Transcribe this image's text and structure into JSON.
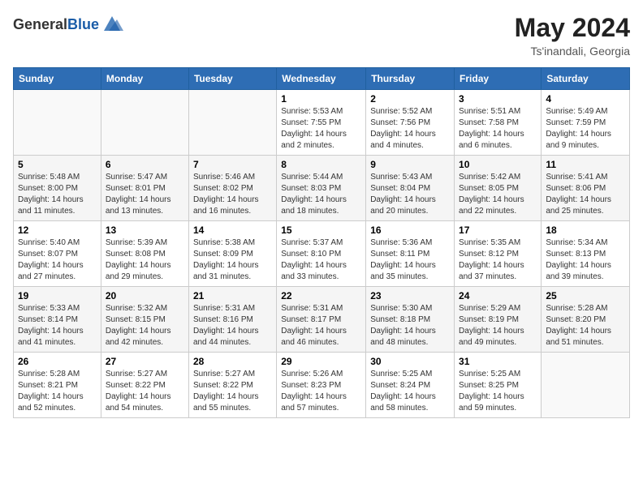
{
  "header": {
    "logo_general": "General",
    "logo_blue": "Blue",
    "title": "May 2024",
    "location": "Ts'inandali, Georgia"
  },
  "calendar": {
    "weekdays": [
      "Sunday",
      "Monday",
      "Tuesday",
      "Wednesday",
      "Thursday",
      "Friday",
      "Saturday"
    ],
    "weeks": [
      [
        {
          "day": "",
          "info": ""
        },
        {
          "day": "",
          "info": ""
        },
        {
          "day": "",
          "info": ""
        },
        {
          "day": "1",
          "info": "Sunrise: 5:53 AM\nSunset: 7:55 PM\nDaylight: 14 hours\nand 2 minutes."
        },
        {
          "day": "2",
          "info": "Sunrise: 5:52 AM\nSunset: 7:56 PM\nDaylight: 14 hours\nand 4 minutes."
        },
        {
          "day": "3",
          "info": "Sunrise: 5:51 AM\nSunset: 7:58 PM\nDaylight: 14 hours\nand 6 minutes."
        },
        {
          "day": "4",
          "info": "Sunrise: 5:49 AM\nSunset: 7:59 PM\nDaylight: 14 hours\nand 9 minutes."
        }
      ],
      [
        {
          "day": "5",
          "info": "Sunrise: 5:48 AM\nSunset: 8:00 PM\nDaylight: 14 hours\nand 11 minutes."
        },
        {
          "day": "6",
          "info": "Sunrise: 5:47 AM\nSunset: 8:01 PM\nDaylight: 14 hours\nand 13 minutes."
        },
        {
          "day": "7",
          "info": "Sunrise: 5:46 AM\nSunset: 8:02 PM\nDaylight: 14 hours\nand 16 minutes."
        },
        {
          "day": "8",
          "info": "Sunrise: 5:44 AM\nSunset: 8:03 PM\nDaylight: 14 hours\nand 18 minutes."
        },
        {
          "day": "9",
          "info": "Sunrise: 5:43 AM\nSunset: 8:04 PM\nDaylight: 14 hours\nand 20 minutes."
        },
        {
          "day": "10",
          "info": "Sunrise: 5:42 AM\nSunset: 8:05 PM\nDaylight: 14 hours\nand 22 minutes."
        },
        {
          "day": "11",
          "info": "Sunrise: 5:41 AM\nSunset: 8:06 PM\nDaylight: 14 hours\nand 25 minutes."
        }
      ],
      [
        {
          "day": "12",
          "info": "Sunrise: 5:40 AM\nSunset: 8:07 PM\nDaylight: 14 hours\nand 27 minutes."
        },
        {
          "day": "13",
          "info": "Sunrise: 5:39 AM\nSunset: 8:08 PM\nDaylight: 14 hours\nand 29 minutes."
        },
        {
          "day": "14",
          "info": "Sunrise: 5:38 AM\nSunset: 8:09 PM\nDaylight: 14 hours\nand 31 minutes."
        },
        {
          "day": "15",
          "info": "Sunrise: 5:37 AM\nSunset: 8:10 PM\nDaylight: 14 hours\nand 33 minutes."
        },
        {
          "day": "16",
          "info": "Sunrise: 5:36 AM\nSunset: 8:11 PM\nDaylight: 14 hours\nand 35 minutes."
        },
        {
          "day": "17",
          "info": "Sunrise: 5:35 AM\nSunset: 8:12 PM\nDaylight: 14 hours\nand 37 minutes."
        },
        {
          "day": "18",
          "info": "Sunrise: 5:34 AM\nSunset: 8:13 PM\nDaylight: 14 hours\nand 39 minutes."
        }
      ],
      [
        {
          "day": "19",
          "info": "Sunrise: 5:33 AM\nSunset: 8:14 PM\nDaylight: 14 hours\nand 41 minutes."
        },
        {
          "day": "20",
          "info": "Sunrise: 5:32 AM\nSunset: 8:15 PM\nDaylight: 14 hours\nand 42 minutes."
        },
        {
          "day": "21",
          "info": "Sunrise: 5:31 AM\nSunset: 8:16 PM\nDaylight: 14 hours\nand 44 minutes."
        },
        {
          "day": "22",
          "info": "Sunrise: 5:31 AM\nSunset: 8:17 PM\nDaylight: 14 hours\nand 46 minutes."
        },
        {
          "day": "23",
          "info": "Sunrise: 5:30 AM\nSunset: 8:18 PM\nDaylight: 14 hours\nand 48 minutes."
        },
        {
          "day": "24",
          "info": "Sunrise: 5:29 AM\nSunset: 8:19 PM\nDaylight: 14 hours\nand 49 minutes."
        },
        {
          "day": "25",
          "info": "Sunrise: 5:28 AM\nSunset: 8:20 PM\nDaylight: 14 hours\nand 51 minutes."
        }
      ],
      [
        {
          "day": "26",
          "info": "Sunrise: 5:28 AM\nSunset: 8:21 PM\nDaylight: 14 hours\nand 52 minutes."
        },
        {
          "day": "27",
          "info": "Sunrise: 5:27 AM\nSunset: 8:22 PM\nDaylight: 14 hours\nand 54 minutes."
        },
        {
          "day": "28",
          "info": "Sunrise: 5:27 AM\nSunset: 8:22 PM\nDaylight: 14 hours\nand 55 minutes."
        },
        {
          "day": "29",
          "info": "Sunrise: 5:26 AM\nSunset: 8:23 PM\nDaylight: 14 hours\nand 57 minutes."
        },
        {
          "day": "30",
          "info": "Sunrise: 5:25 AM\nSunset: 8:24 PM\nDaylight: 14 hours\nand 58 minutes."
        },
        {
          "day": "31",
          "info": "Sunrise: 5:25 AM\nSunset: 8:25 PM\nDaylight: 14 hours\nand 59 minutes."
        },
        {
          "day": "",
          "info": ""
        }
      ]
    ]
  }
}
